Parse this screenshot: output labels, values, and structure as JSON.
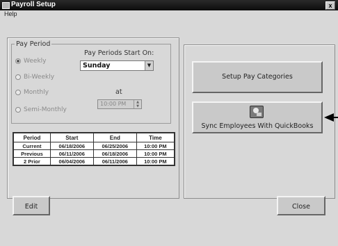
{
  "window": {
    "title": "Payroll Setup",
    "close_glyph": "x"
  },
  "menu": {
    "items": [
      "Help"
    ]
  },
  "pay_period": {
    "legend": "Pay Period",
    "options": [
      {
        "label": "Weekly",
        "selected": true
      },
      {
        "label": "Bi-Weekly",
        "selected": false
      },
      {
        "label": "Monthly",
        "selected": false
      },
      {
        "label": "Semi-Monthly",
        "selected": false
      }
    ],
    "start_label": "Pay Periods Start On:",
    "start_value": "Sunday",
    "at_label": "at",
    "time_value": "10:00 PM"
  },
  "periods_table": {
    "headers": [
      "Period",
      "Start",
      "End",
      "Time"
    ],
    "rows": [
      [
        "Current",
        "06/18/2006",
        "06/25/2006",
        "10:00 PM"
      ],
      [
        "Previous",
        "06/11/2006",
        "06/18/2006",
        "10:00 PM"
      ],
      [
        "2 Prior",
        "06/04/2006",
        "06/11/2006",
        "10:00 PM"
      ]
    ]
  },
  "buttons": {
    "setup_pay_categories": "Setup Pay Categories",
    "sync_quickbooks": "Sync Employees With QuickBooks",
    "edit": "Edit",
    "close": "Close"
  },
  "icons": {
    "app": "payroll-app-icon",
    "sync": "quickbooks-sync-icon",
    "dropdown": "chevron-down-icon",
    "annotation": "arrow-left-icon"
  }
}
